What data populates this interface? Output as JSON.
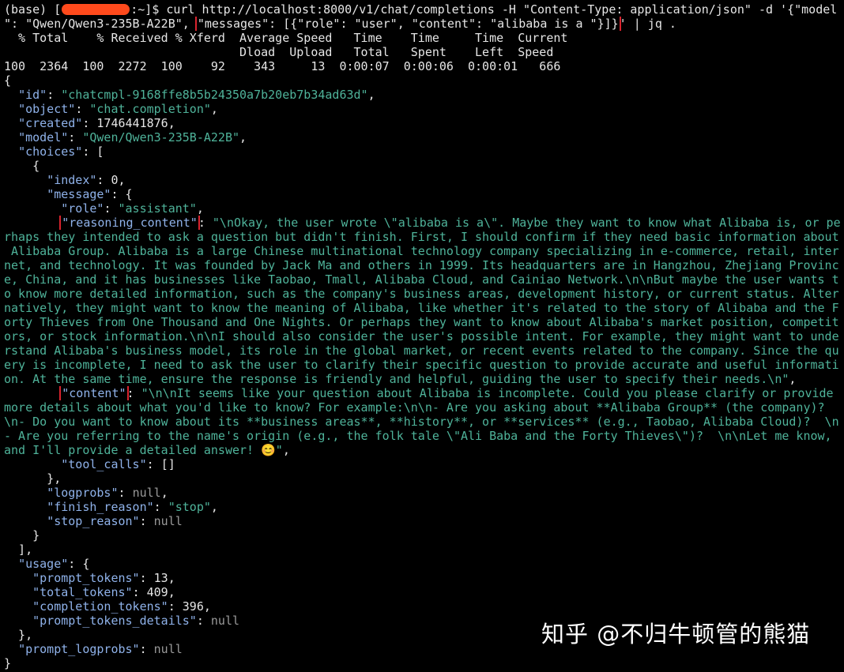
{
  "prompt": {
    "prefix": "(base) [",
    "suffix": ":~]$ ",
    "command_1": "curl http://localhost:8000/v1/chat/completions -H \"Content-Type: application/json\" -d '{\"model",
    "command_2_a": "\": \"Qwen/Qwen3-235B-A22B\", ",
    "command_2_box": "\"messages\": [{\"role\": \"user\", \"content\": \"alibaba is a \"}]}",
    "command_2_b": "' | jq ."
  },
  "curl_progress": {
    "header_1": "  % Total    % Received % Xferd  Average Speed   Time    Time     Time  Current",
    "header_2": "                                 Dload  Upload   Total   Spent    Left  Speed",
    "row": "100  2364  100  2272  100    92    343     13  0:00:07  0:00:06  0:00:01   666"
  },
  "json": {
    "open": "{",
    "id_key": "\"id\"",
    "id_val": "\"chatcmpl-9168ffe8b5b24350a7b20eb7b34ad63d\"",
    "object_key": "\"object\"",
    "object_val": "\"chat.completion\"",
    "created_key": "\"created\"",
    "created_val": "1746441876",
    "model_key": "\"model\"",
    "model_val": "\"Qwen/Qwen3-235B-A22B\"",
    "choices_key": "\"choices\"",
    "index_key": "\"index\"",
    "index_val": "0",
    "message_key": "\"message\"",
    "role_key": "\"role\"",
    "role_val": "\"assistant\"",
    "reasoning_key": "\"reasoning_content\"",
    "reasoning_lines": [
      "\"\\nOkay, the user wrote \\\"alibaba is a\\\". Maybe they want to know what Alibaba is, or pe",
      "rhaps they intended to ask a question but didn't finish. First, I should confirm if they need basic information about",
      " Alibaba Group. Alibaba is a large Chinese multinational technology company specializing in e-commerce, retail, inter",
      "net, and technology. It was founded by Jack Ma and others in 1999. Its headquarters are in Hangzhou, Zhejiang Provinc",
      "e, China, and it has businesses like Taobao, Tmall, Alibaba Cloud, and Cainiao Network.\\n\\nBut maybe the user wants t",
      "o know more detailed information, such as the company's business areas, development history, or current status. Alter",
      "natively, they might want to know the meaning of Alibaba, like whether it's related to the story of Alibaba and the F",
      "orty Thieves from One Thousand and One Nights. Or perhaps they want to know about Alibaba's market position, competit",
      "ors, or stock information.\\n\\nI should also consider the user's possible intent. For example, they might want to unde",
      "rstand Alibaba's business model, its role in the global market, or recent events related to the company. Since the qu",
      "ery is incomplete, I need to ask the user to clarify their specific question to provide accurate and useful informati",
      "on. At the same time, ensure the response is friendly and helpful, guiding the user to specify their needs.\\n\""
    ],
    "content_key": "\"content\"",
    "content_lines": [
      "\"\\n\\nIt seems like your question about Alibaba is incomplete. Could you please clarify or provide",
      "more details about what you'd like to know? For example:\\n\\n- Are you asking about **Alibaba Group** (the company)?",
      "\\n- Do you want to know about its **business areas**, **history**, or **services** (e.g., Taobao, Alibaba Cloud)?  \\n",
      "- Are you referring to the name's origin (e.g., the folk tale \\\"Ali Baba and the Forty Thieves\\\")?  \\n\\nLet me know,",
      "and I'll provide a detailed answer! 😊\""
    ],
    "tool_calls_key": "\"tool_calls\"",
    "tool_calls_val": "[]",
    "logprobs_key": "\"logprobs\"",
    "null_val": "null",
    "finish_reason_key": "\"finish_reason\"",
    "finish_reason_val": "\"stop\"",
    "stop_reason_key": "\"stop_reason\"",
    "usage_key": "\"usage\"",
    "prompt_tokens_key": "\"prompt_tokens\"",
    "prompt_tokens_val": "13",
    "total_tokens_key": "\"total_tokens\"",
    "total_tokens_val": "409",
    "completion_tokens_key": "\"completion_tokens\"",
    "completion_tokens_val": "396",
    "prompt_tokens_details_key": "\"prompt_tokens_details\"",
    "prompt_logprobs_key": "\"prompt_logprobs\"",
    "close": "}"
  },
  "watermark": "知乎 @不归牛顿管的熊猫",
  "colors": {
    "background": "#000000",
    "key": "#8fb2ea",
    "string": "#4fb39a",
    "text": "#e6e6e6",
    "highlight_box": "#d9232e",
    "redaction": "#ff4a1c"
  }
}
